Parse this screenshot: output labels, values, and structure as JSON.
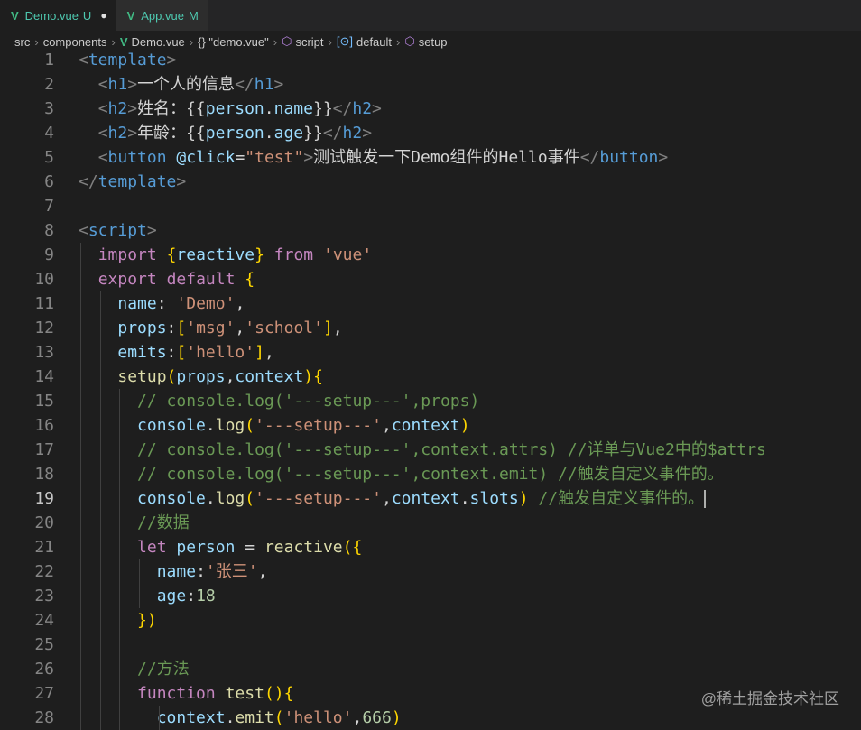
{
  "tabs": [
    {
      "label": "Demo.vue",
      "status": "U",
      "dirty": "●",
      "icon": "vue-icon"
    },
    {
      "label": "App.vue",
      "status": "M",
      "icon": "vue-icon"
    }
  ],
  "breadcrumb": {
    "src": "src",
    "components": "components",
    "file": "Demo.vue",
    "block": "{} \"demo.vue\"",
    "script": "script",
    "default": "default",
    "setup": "setup"
  },
  "editor": {
    "current_line": 19,
    "lines": [
      "<template>",
      "  <h1>一个人的信息</h1>",
      "  <h2>姓名：{{person.name}}</h2>",
      "  <h2>年龄：{{person.age}}</h2>",
      "  <button @click=\"test\">测试触发一下Demo组件的Hello事件</button>",
      "</template>",
      "",
      "<script>",
      "  import {reactive} from 'vue'",
      "  export default {",
      "    name: 'Demo',",
      "    props:['msg','school'],",
      "    emits:['hello'],",
      "    setup(props,context){",
      "      // console.log('---setup---',props)",
      "      console.log('---setup---',context)",
      "      // console.log('---setup---',context.attrs) //详单与Vue2中的$attrs",
      "      // console.log('---setup---',context.emit) //触发自定义事件的。",
      "      console.log('---setup---',context.slots) //触发自定义事件的。",
      "      //数据",
      "      let person = reactive({",
      "        name:'张三',",
      "        age:18",
      "      })",
      "",
      "      //方法",
      "      function test(){",
      "        context.emit('hello',666)"
    ]
  },
  "watermark": "@稀土掘金技术社区"
}
